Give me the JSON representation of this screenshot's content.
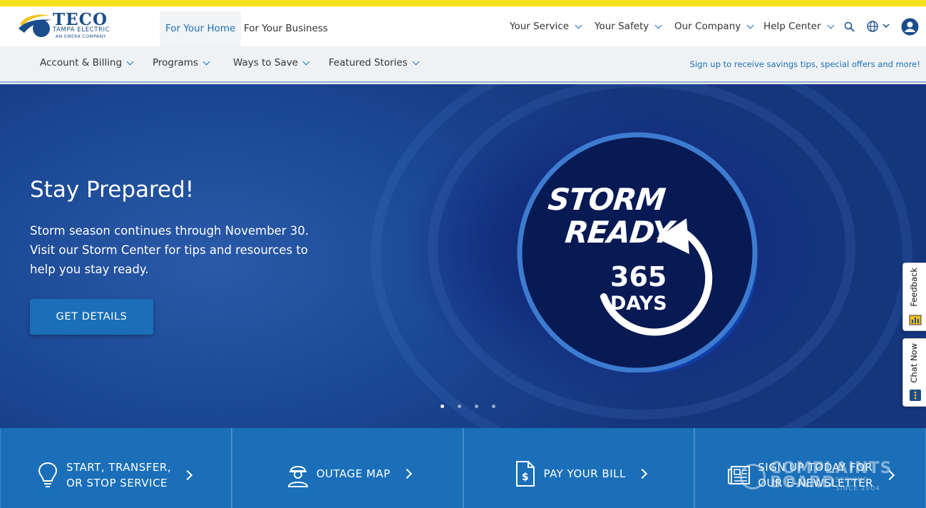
{
  "brand": {
    "logo_name": "TECO",
    "logo_sub": "TAMPA ELECTRIC",
    "logo_sub2": "AN EMERA COMPANY",
    "primary_color": "#1a6fb8",
    "accent_color": "#f6e21c"
  },
  "segments": [
    {
      "label": "For Your Home",
      "active": true
    },
    {
      "label": "For Your Business",
      "active": false
    }
  ],
  "top_nav": {
    "items": [
      "Your Service",
      "Your Safety",
      "Our Company",
      "Help Center"
    ],
    "icons": [
      "search-icon",
      "globe-icon",
      "user-icon"
    ]
  },
  "sub_nav": {
    "items": [
      "Account & Billing",
      "Programs",
      "Ways to Save",
      "Featured Stories"
    ],
    "signup_link": "Sign up to receive savings tips, special offers and more!"
  },
  "hero": {
    "title": "Stay Prepared!",
    "text": "Storm season continues through November 30. Visit our Storm Center for tips and resources to help you stay ready.",
    "button": "GET DETAILS",
    "badge_line1": "STORM",
    "badge_line2": "READY",
    "badge_number": "365",
    "badge_days": "DAYS",
    "slide_count": 4,
    "active_slide": 1
  },
  "side_tabs": {
    "feedback": "Feedback",
    "chat": "Chat Now"
  },
  "quick_links": [
    {
      "label": "START, TRANSFER,\nOR STOP SERVICE",
      "icon": "lightbulb-icon"
    },
    {
      "label": "OUTAGE MAP",
      "icon": "worker-icon"
    },
    {
      "label": "PAY YOUR BILL",
      "icon": "bill-icon"
    },
    {
      "label": "SIGN UP TODAY FOR\nOUR E-NEWSLETTER",
      "icon": "newsletter-icon"
    }
  ],
  "watermark": {
    "line1": "COMPLAINTS",
    "line2": "BOARD",
    "line3": "SERVING",
    "line4": "SINCE 2004"
  }
}
